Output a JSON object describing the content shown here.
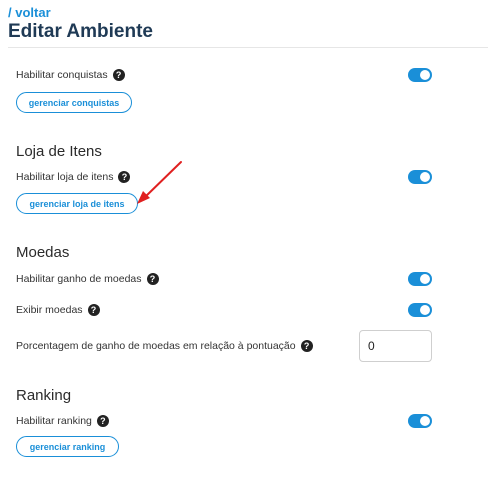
{
  "header": {
    "breadcrumb": "/ voltar",
    "title": "Editar Ambiente"
  },
  "conquistas": {
    "enable_label": "Habilitar conquistas",
    "enabled": true,
    "manage_button": "gerenciar conquistas"
  },
  "loja": {
    "title": "Loja de Itens",
    "enable_label": "Habilitar loja de itens",
    "enabled": true,
    "manage_button": "gerenciar loja de itens"
  },
  "moedas": {
    "title": "Moedas",
    "earn_label": "Habilitar ganho de moedas",
    "earn_enabled": true,
    "show_label": "Exibir moedas",
    "show_enabled": true,
    "percent_label": "Porcentagem de ganho de moedas em relação à pontuação",
    "percent_value": "0"
  },
  "ranking": {
    "title": "Ranking",
    "enable_label": "Habilitar ranking",
    "enabled": true,
    "manage_button": "gerenciar ranking"
  },
  "icons": {
    "help": "question-circle-icon",
    "annotation": "red-arrow-annotation"
  },
  "colors": {
    "accent": "#1a8fd8",
    "title": "#1f3a55",
    "annotation": "#e02020"
  }
}
